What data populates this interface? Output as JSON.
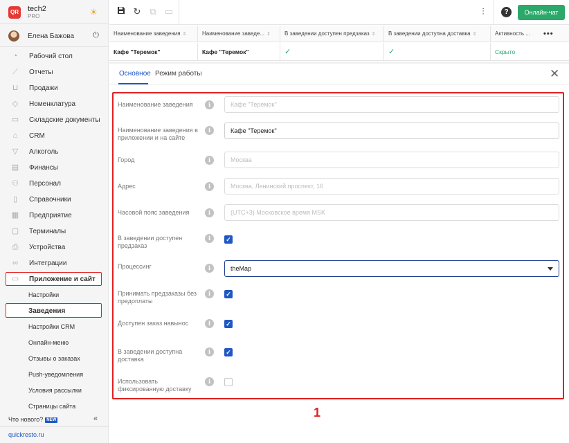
{
  "brand": {
    "logo": "QR",
    "name": "tech2",
    "plan": "PRO"
  },
  "user": {
    "name": "Елена Бажова"
  },
  "nav": [
    {
      "label": "Рабочий стол",
      "icon": "dashboard-icon"
    },
    {
      "label": "Отчеты",
      "icon": "reports-icon"
    },
    {
      "label": "Продажи",
      "icon": "sales-icon"
    },
    {
      "label": "Номенклатура",
      "icon": "nomenclature-icon"
    },
    {
      "label": "Складские документы",
      "icon": "warehouse-icon"
    },
    {
      "label": "CRM",
      "icon": "crm-icon"
    },
    {
      "label": "Алкоголь",
      "icon": "alcohol-icon"
    },
    {
      "label": "Финансы",
      "icon": "finance-icon"
    },
    {
      "label": "Персонал",
      "icon": "staff-icon"
    },
    {
      "label": "Справочники",
      "icon": "directory-icon"
    },
    {
      "label": "Предприятие",
      "icon": "enterprise-icon"
    },
    {
      "label": "Терминалы",
      "icon": "terminal-icon"
    },
    {
      "label": "Устройства",
      "icon": "devices-icon"
    },
    {
      "label": "Интеграции",
      "icon": "integrations-icon"
    },
    {
      "label": "Приложение и сайт",
      "icon": "app-site-icon"
    }
  ],
  "subnav": [
    {
      "label": "Настройки"
    },
    {
      "label": "Заведения"
    },
    {
      "label": "Настройки CRM"
    },
    {
      "label": "Онлайн-меню"
    },
    {
      "label": "Отзывы о заказах"
    },
    {
      "label": "Push-уведомления"
    },
    {
      "label": "Условия рассылки"
    },
    {
      "label": "Страницы сайта"
    }
  ],
  "footer": {
    "news": "Что нового?",
    "badge": "NEW",
    "site": "quickresto.ru"
  },
  "toolbar": {
    "chat": "Онлайн-чат"
  },
  "table": {
    "headers": [
      "Наименование заведения",
      "Наименование заведе...",
      "В заведении доступен предзаказ",
      "В заведении доступна доставка",
      "Активность ..."
    ],
    "row": {
      "name": "Кафе \"Теремок\"",
      "app_name": "Кафе \"Теремок\"",
      "preorder": "✓",
      "delivery": "✓",
      "status": "Скрыто"
    }
  },
  "tabs": {
    "main": "Основное",
    "schedule": "Режим работы"
  },
  "form": {
    "name_label": "Наименование заведения",
    "name_placeholder": "Кафе \"Теремок\"",
    "app_name_label": "Наименование заведения в приложении и на сайте",
    "app_name_value": "Кафе \"Теремок\"",
    "city_label": "Город",
    "city_placeholder": "Москва",
    "address_label": "Адрес",
    "address_placeholder": "Москва, Ленинский проспект, 16",
    "tz_label": "Часовой пояс заведения",
    "tz_placeholder": "(UTC+3) Московское время MSK",
    "preorder_label": "В заведении доступен предзаказ",
    "preorder_checked": true,
    "processing_label": "Процессинг",
    "processing_value": "theMap",
    "no_prepay_label": "Принимать предзаказы без предоплаты",
    "no_prepay_checked": true,
    "takeaway_label": "Доступен заказ навынос",
    "takeaway_checked": true,
    "delivery_label": "В заведении доступна доставка",
    "delivery_checked": true,
    "fixed_delivery_label": "Использовать фиксированную доставку",
    "fixed_delivery_checked": false
  },
  "annotation": "1",
  "colors": {
    "accent": "#1f57c3",
    "chat": "#2ba86a",
    "highlight": "#e02020"
  }
}
